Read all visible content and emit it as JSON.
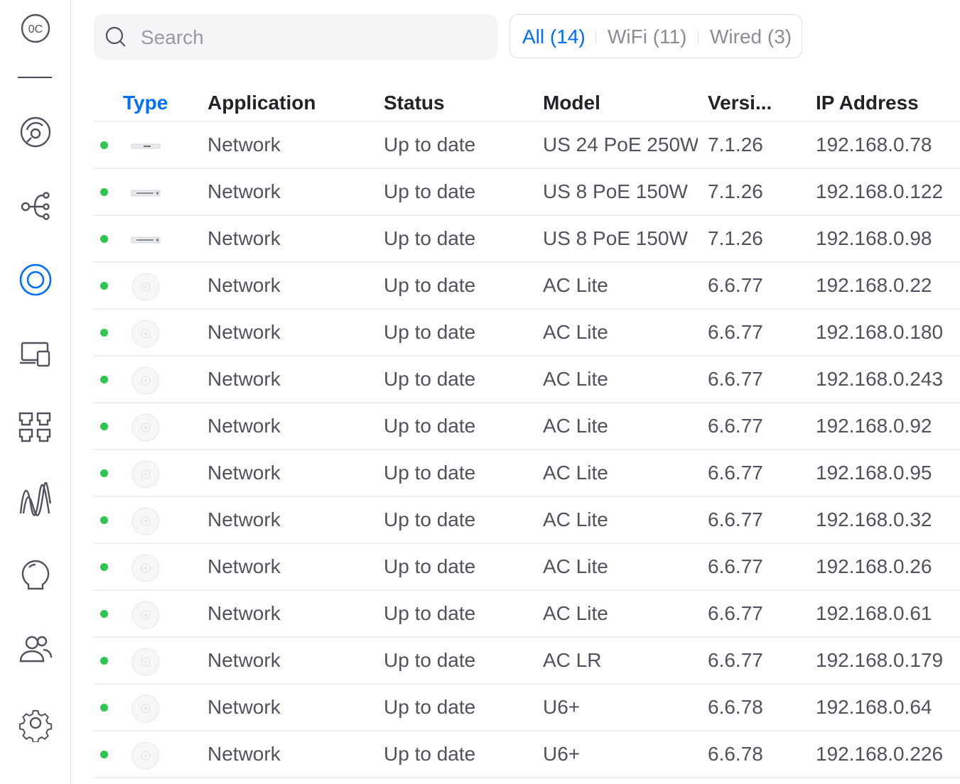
{
  "sidebar": {
    "items": [
      {
        "icon": "organization-logo-icon",
        "label": "0C"
      },
      {
        "icon": "dashboard-icon"
      },
      {
        "icon": "topology-icon"
      },
      {
        "icon": "devices-icon",
        "active": true
      },
      {
        "icon": "clients-icon"
      },
      {
        "icon": "ports-icon"
      },
      {
        "icon": "statistics-icon"
      },
      {
        "icon": "insights-icon"
      },
      {
        "icon": "users-icon"
      },
      {
        "icon": "settings-icon"
      }
    ]
  },
  "search": {
    "placeholder": "Search",
    "value": ""
  },
  "filters": {
    "all": "All (14)",
    "wifi": "WiFi (11)",
    "wired": "Wired (3)",
    "active": "all"
  },
  "table": {
    "columns": {
      "type": "Type",
      "application": "Application",
      "status": "Status",
      "model": "Model",
      "version": "Versi...",
      "ip": "IP Address"
    },
    "sorted_column": "type",
    "rows": [
      {
        "device": "switch-24",
        "application": "Network",
        "status": "Up to date",
        "model": "US 24 PoE 250W",
        "version": "7.1.26",
        "ip": "192.168.0.78"
      },
      {
        "device": "switch-8",
        "application": "Network",
        "status": "Up to date",
        "model": "US 8 PoE 150W",
        "version": "7.1.26",
        "ip": "192.168.0.122"
      },
      {
        "device": "switch-8",
        "application": "Network",
        "status": "Up to date",
        "model": "US 8 PoE 150W",
        "version": "7.1.26",
        "ip": "192.168.0.98"
      },
      {
        "device": "access-point",
        "application": "Network",
        "status": "Up to date",
        "model": "AC Lite",
        "version": "6.6.77",
        "ip": "192.168.0.22"
      },
      {
        "device": "access-point",
        "application": "Network",
        "status": "Up to date",
        "model": "AC Lite",
        "version": "6.6.77",
        "ip": "192.168.0.180"
      },
      {
        "device": "access-point",
        "application": "Network",
        "status": "Up to date",
        "model": "AC Lite",
        "version": "6.6.77",
        "ip": "192.168.0.243"
      },
      {
        "device": "access-point",
        "application": "Network",
        "status": "Up to date",
        "model": "AC Lite",
        "version": "6.6.77",
        "ip": "192.168.0.92"
      },
      {
        "device": "access-point",
        "application": "Network",
        "status": "Up to date",
        "model": "AC Lite",
        "version": "6.6.77",
        "ip": "192.168.0.95"
      },
      {
        "device": "access-point",
        "application": "Network",
        "status": "Up to date",
        "model": "AC Lite",
        "version": "6.6.77",
        "ip": "192.168.0.32"
      },
      {
        "device": "access-point",
        "application": "Network",
        "status": "Up to date",
        "model": "AC Lite",
        "version": "6.6.77",
        "ip": "192.168.0.26"
      },
      {
        "device": "access-point",
        "application": "Network",
        "status": "Up to date",
        "model": "AC Lite",
        "version": "6.6.77",
        "ip": "192.168.0.61"
      },
      {
        "device": "access-point",
        "application": "Network",
        "status": "Up to date",
        "model": "AC LR",
        "version": "6.6.77",
        "ip": "192.168.0.179"
      },
      {
        "device": "access-point",
        "application": "Network",
        "status": "Up to date",
        "model": "U6+",
        "version": "6.6.78",
        "ip": "192.168.0.64"
      },
      {
        "device": "access-point",
        "application": "Network",
        "status": "Up to date",
        "model": "U6+",
        "version": "6.6.78",
        "ip": "192.168.0.226"
      }
    ]
  },
  "colors": {
    "accent": "#006fff",
    "status_online": "#2cc84d",
    "icon_gray": "#50535b"
  }
}
